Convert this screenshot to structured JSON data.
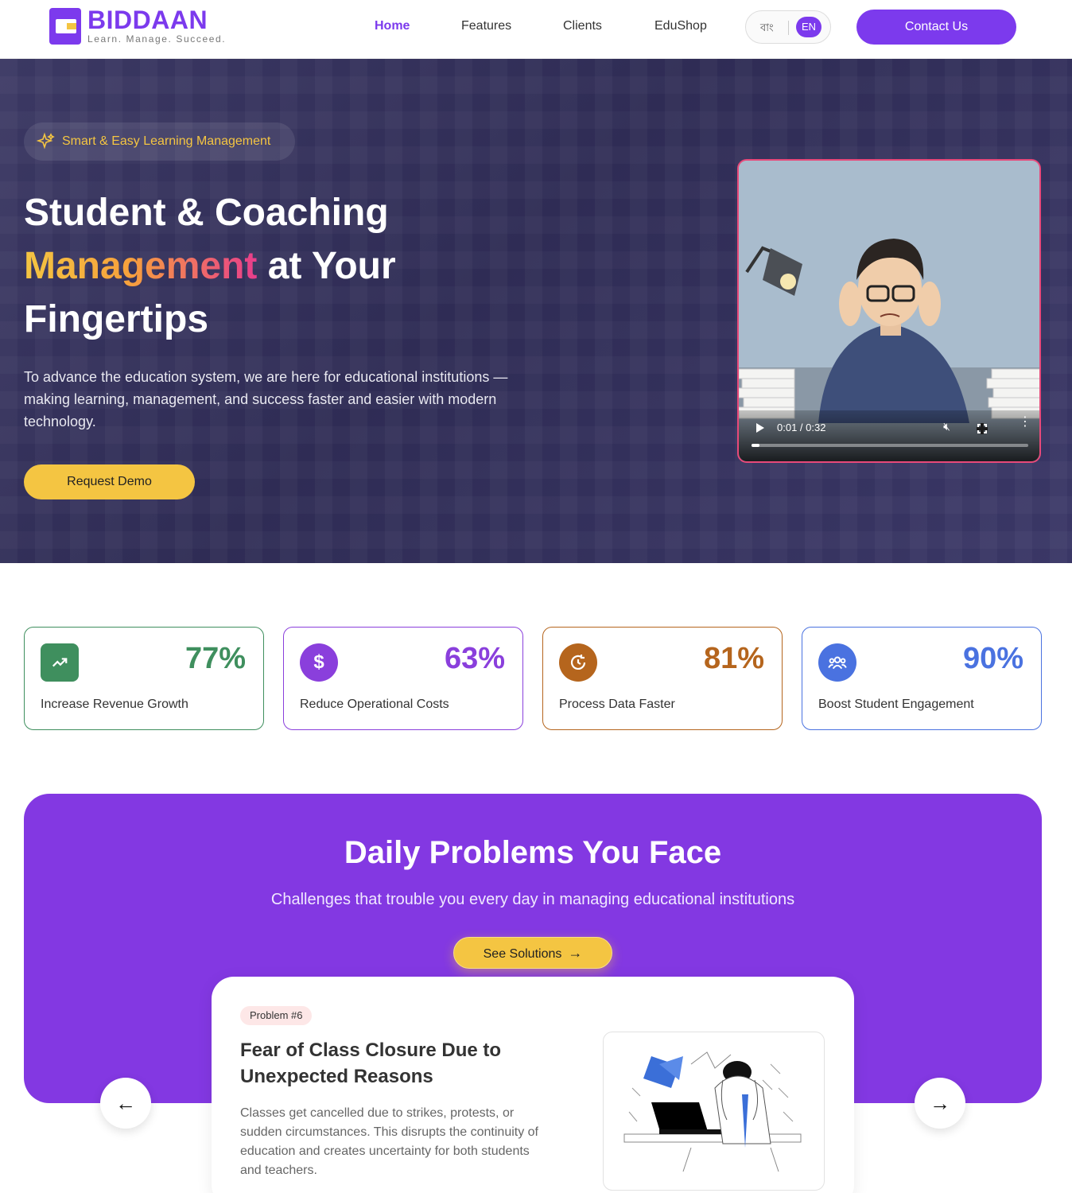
{
  "brand": {
    "name": "BIDDAAN",
    "tagline": "Learn. Manage. Succeed."
  },
  "nav": {
    "links": [
      {
        "label": "Home",
        "active": true
      },
      {
        "label": "Features",
        "active": false
      },
      {
        "label": "Clients",
        "active": false
      },
      {
        "label": "EduShop",
        "active": false
      }
    ],
    "lang": {
      "bn": "বাং",
      "en": "EN",
      "selected": "EN"
    },
    "contact_label": "Contact Us"
  },
  "hero": {
    "badge": "Smart & Easy Learning Management",
    "title_part1": "Student & Coaching",
    "title_highlight": "Management",
    "title_part2": "at Your",
    "title_part3": "Fingertips",
    "description": "To advance the education system, we are here for educational institutions — making learning, management, and success faster and easier with modern technology.",
    "demo_label": "Request Demo",
    "video": {
      "current_time": "0:01",
      "duration": "0:32",
      "time_display": "0:01 / 0:32",
      "progress": 0.03,
      "muted": true
    }
  },
  "stats": [
    {
      "value": "77%",
      "label": "Increase Revenue Growth",
      "icon": "trending-up-icon",
      "color": "#3f8f5e"
    },
    {
      "value": "63%",
      "label": "Reduce Operational Costs",
      "icon": "dollar-icon",
      "color": "#8a3fdc"
    },
    {
      "value": "81%",
      "label": "Process Data Faster",
      "icon": "refresh-clock-icon",
      "color": "#b5651d"
    },
    {
      "value": "90%",
      "label": "Boost Student Engagement",
      "icon": "users-icon",
      "color": "#4a72e0"
    }
  ],
  "problems": {
    "title": "Daily Problems You Face",
    "subtitle": "Challenges that trouble you every day in managing educational institutions",
    "see_label": "See Solutions",
    "card": {
      "badge": "Problem #6",
      "title": "Fear of Class Closure Due to Unexpected Reasons",
      "description": "Classes get cancelled due to strikes, protests, or sudden circumstances. This disrupts the continuity of education and creates uncertainty for both students and teachers."
    }
  },
  "colors": {
    "accent": "#7c3aed",
    "yellow": "#f4c542",
    "hero_bg": "#34315c",
    "problems_bg": "#8338e2"
  }
}
